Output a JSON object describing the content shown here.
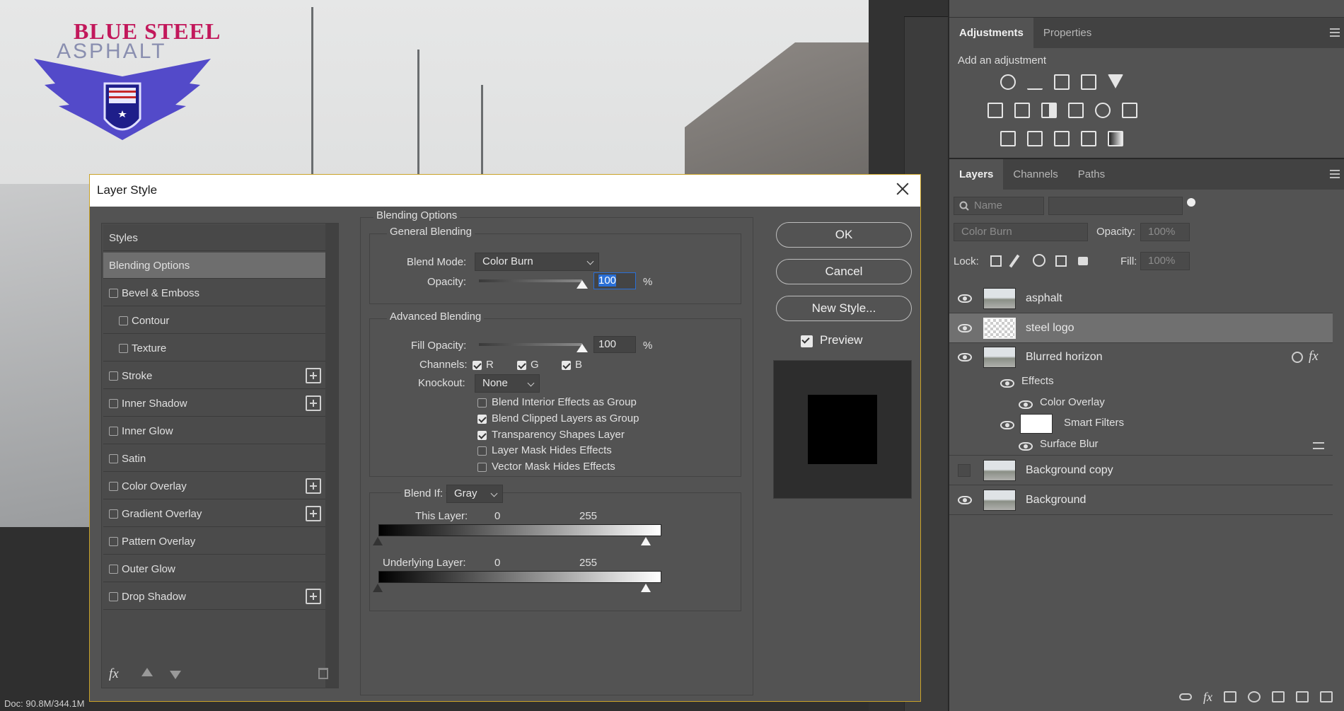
{
  "canvas": {
    "logo_line1": "BLUE STEEL",
    "logo_line2": "ASPHALT"
  },
  "status_bar": {
    "doc": "Doc: 90.8M/344.1M"
  },
  "adjustments": {
    "tabs": [
      "Adjustments",
      "Properties"
    ],
    "title": "Add an adjustment",
    "icons_row1": [
      "brightness-contrast-icon",
      "levels-icon",
      "curves-icon",
      "exposure-icon",
      "vibrance-icon"
    ],
    "icons_row2": [
      "hue-saturation-icon",
      "color-balance-icon",
      "black-white-icon",
      "photo-filter-icon",
      "channel-mixer-icon",
      "color-lookup-icon"
    ],
    "icons_row3": [
      "invert-icon",
      "posterize-icon",
      "threshold-icon",
      "selective-color-icon",
      "gradient-map-icon"
    ]
  },
  "layers_panel": {
    "tabs": [
      "Layers",
      "Channels",
      "Paths"
    ],
    "filter_placeholder": "Name",
    "blend_mode": "Color Burn",
    "opacity_label": "Opacity:",
    "opacity_value": "100%",
    "lock_label": "Lock:",
    "fill_label": "Fill:",
    "fill_value": "100%",
    "layers": [
      {
        "name": "asphalt",
        "visible": true
      },
      {
        "name": "steel logo",
        "visible": true,
        "selected": true
      },
      {
        "name": "Blurred horizon",
        "visible": true
      },
      {
        "name": "Background copy",
        "visible": false
      },
      {
        "name": "Background",
        "visible": true
      }
    ],
    "effects_label": "Effects",
    "color_overlay": "Color Overlay",
    "smart_filters": "Smart Filters",
    "surface_blur": "Surface Blur"
  },
  "dialog": {
    "title": "Layer Style",
    "styles_header": "Styles",
    "styles": [
      {
        "label": "Blending Options",
        "selected": true
      },
      {
        "label": "Bevel & Emboss",
        "checked": false
      },
      {
        "label": "Contour",
        "checked": false,
        "indent": true
      },
      {
        "label": "Texture",
        "checked": false,
        "indent": true
      },
      {
        "label": "Stroke",
        "checked": false,
        "plus": true
      },
      {
        "label": "Inner Shadow",
        "checked": false,
        "plus": true
      },
      {
        "label": "Inner Glow",
        "checked": false
      },
      {
        "label": "Satin",
        "checked": false
      },
      {
        "label": "Color Overlay",
        "checked": false,
        "plus": true
      },
      {
        "label": "Gradient Overlay",
        "checked": false,
        "plus": true
      },
      {
        "label": "Pattern Overlay",
        "checked": false
      },
      {
        "label": "Outer Glow",
        "checked": false
      },
      {
        "label": "Drop Shadow",
        "checked": false,
        "plus": true
      }
    ],
    "blending_options": "Blending Options",
    "general_blending": "General Blending",
    "blend_mode_label": "Blend Mode:",
    "blend_mode_value": "Color Burn",
    "opacity_label": "Opacity:",
    "opacity_value": "100",
    "opacity_fraction": 1.0,
    "percent": "%",
    "advanced_blending": "Advanced Blending",
    "fill_opacity_label": "Fill Opacity:",
    "fill_opacity_value": "100",
    "channels_label": "Channels:",
    "channel_r": "R",
    "channel_g": "G",
    "channel_b": "B",
    "knockout_label": "Knockout:",
    "knockout_value": "None",
    "options": [
      {
        "label": "Blend Interior Effects as Group",
        "checked": false
      },
      {
        "label": "Blend Clipped Layers as Group",
        "checked": true
      },
      {
        "label": "Transparency Shapes Layer",
        "checked": true
      },
      {
        "label": "Layer Mask Hides Effects",
        "checked": false
      },
      {
        "label": "Vector Mask Hides Effects",
        "checked": false
      }
    ],
    "blend_if_label": "Blend If:",
    "blend_if_value": "Gray",
    "this_layer_label": "This Layer:",
    "underlying_layer_label": "Underlying Layer:",
    "range_min": "0",
    "range_max": "255",
    "ok": "OK",
    "cancel": "Cancel",
    "new_style": "New Style...",
    "preview": "Preview"
  }
}
